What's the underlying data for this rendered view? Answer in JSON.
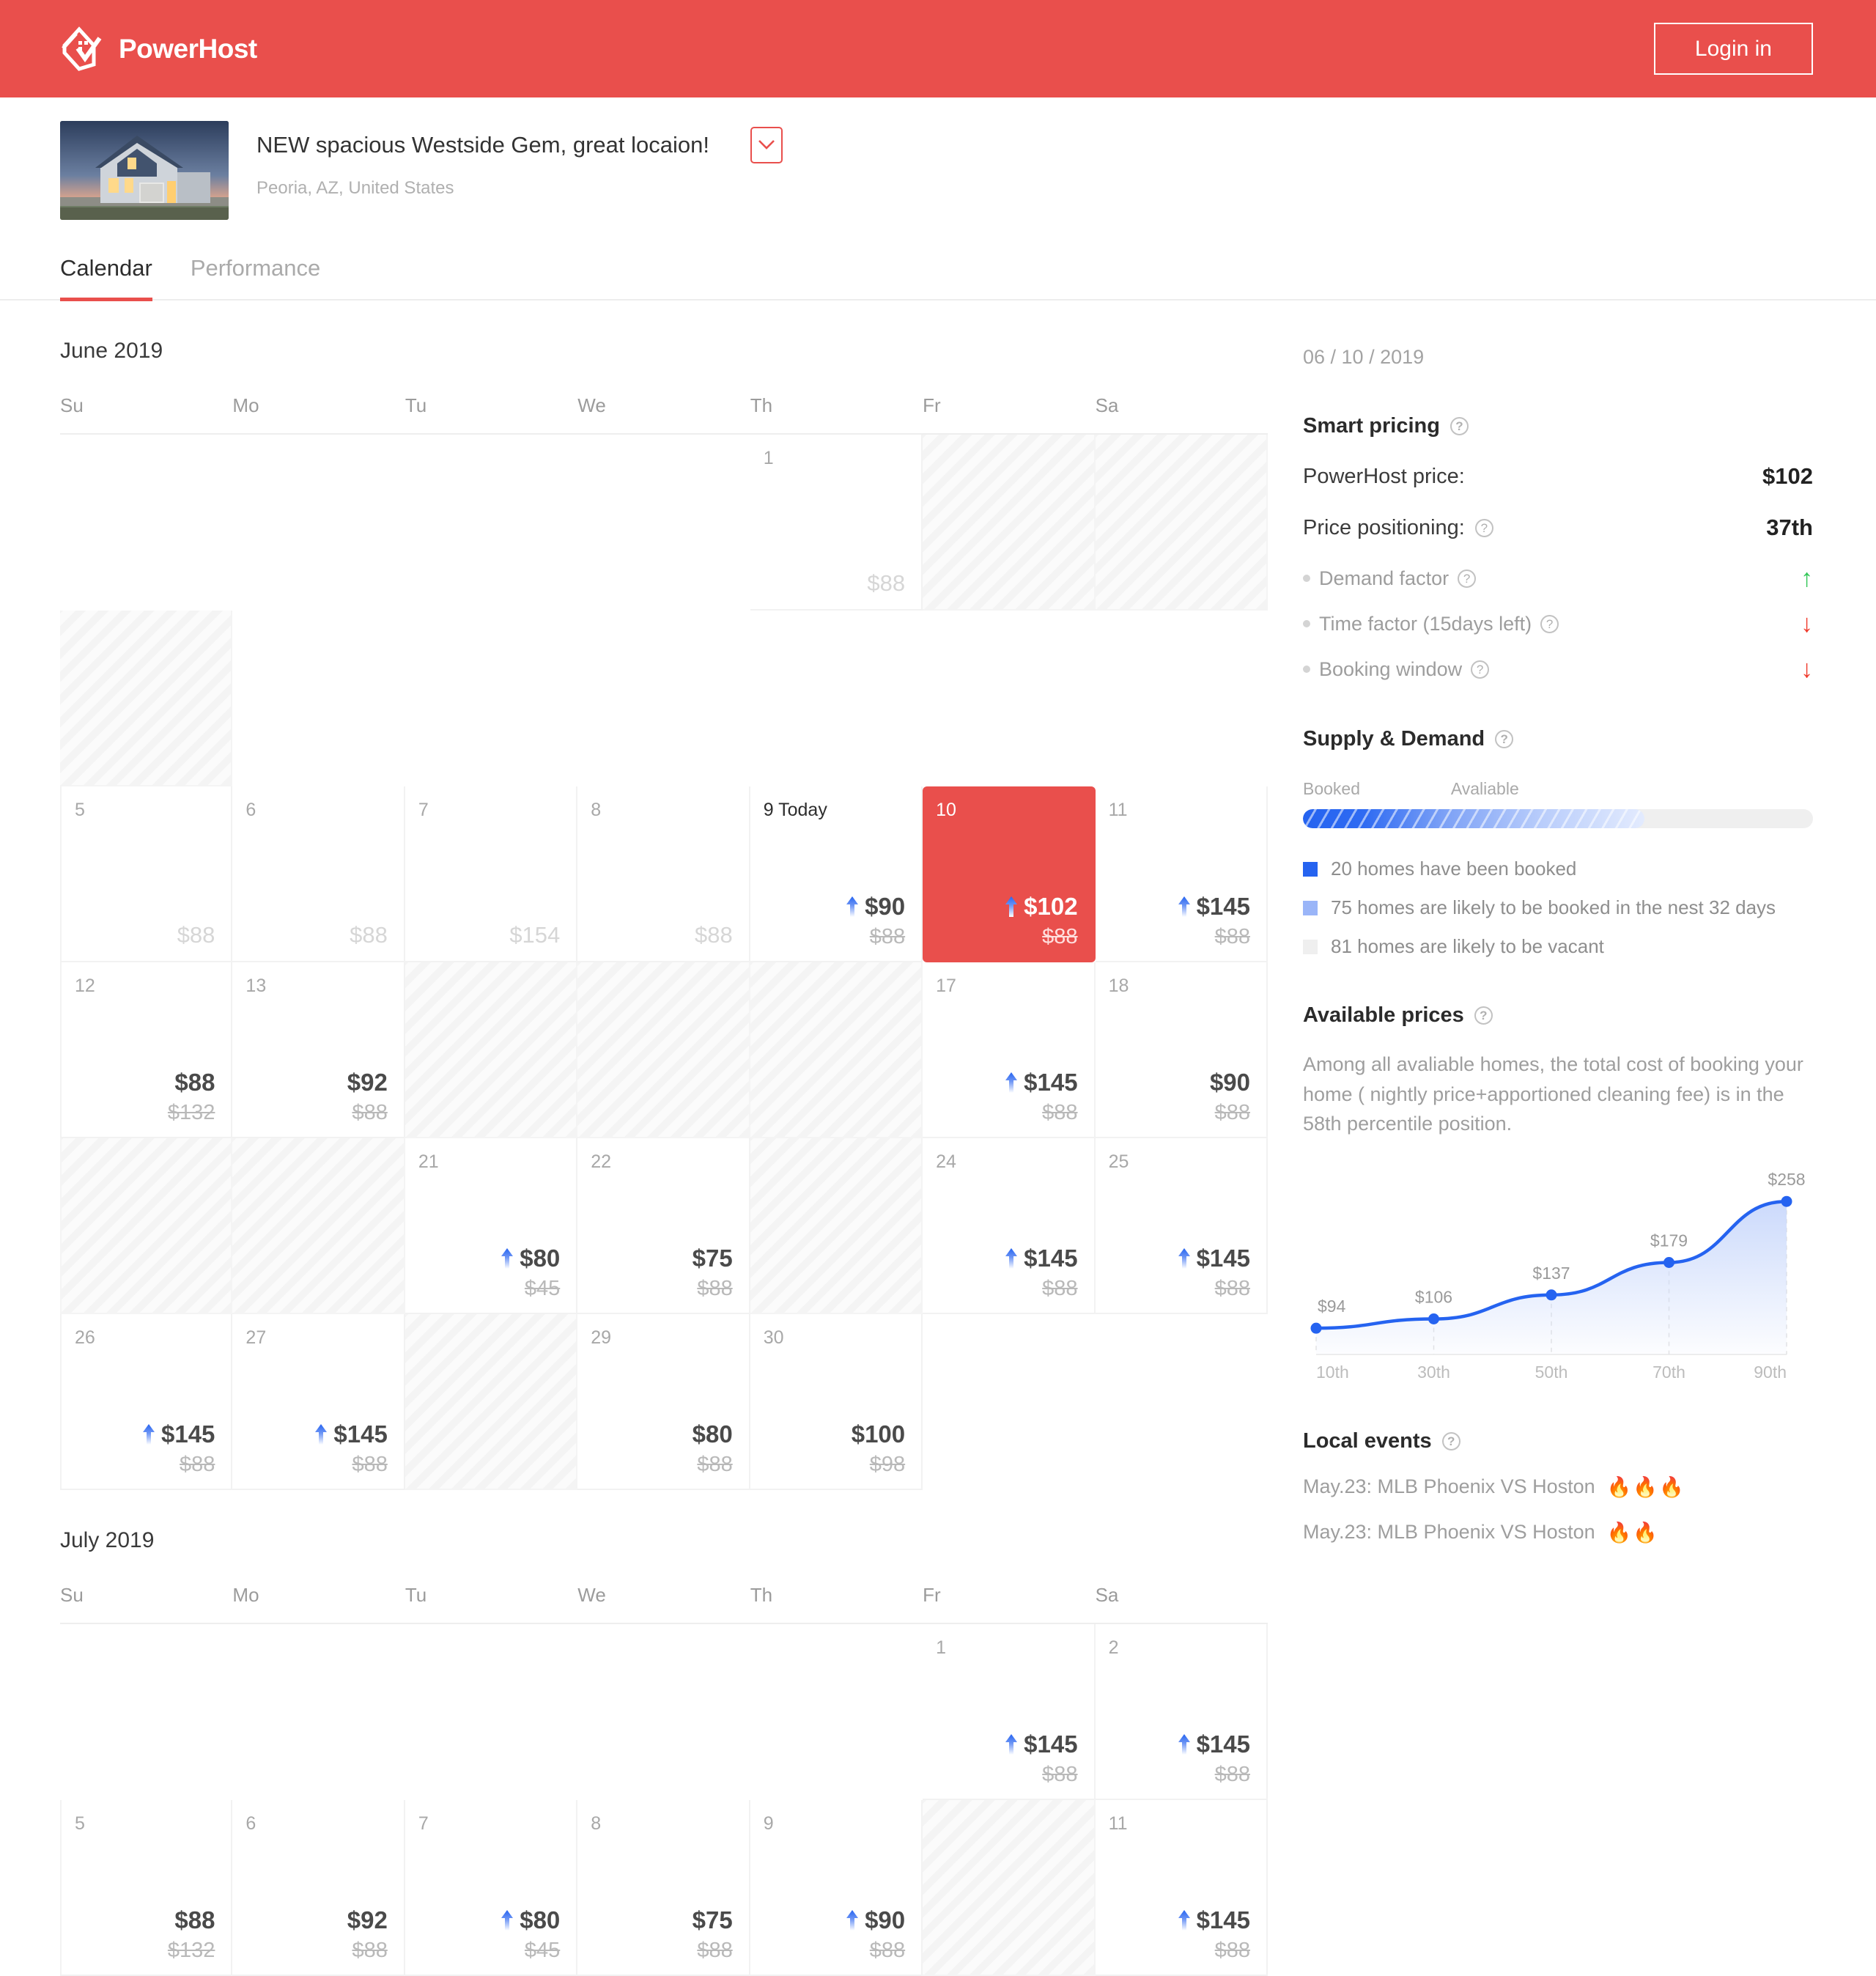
{
  "brand": {
    "name": "PowerHost",
    "logo_icon": "powerhost-logo-icon"
  },
  "header": {
    "login_label": "Login in"
  },
  "listing": {
    "title": "NEW spacious Westside Gem, great locaion!",
    "location": "Peoria, AZ, United States",
    "expand_icon": "chevron-down-icon",
    "thumbnail_alt": "house-photo"
  },
  "tabs": [
    {
      "label": "Calendar",
      "active": true
    },
    {
      "label": "Performance",
      "active": false
    }
  ],
  "calendar": {
    "dow": [
      "Su",
      "Mo",
      "Tu",
      "We",
      "Th",
      "Fr",
      "Sa"
    ],
    "months": [
      {
        "title": "June 2019",
        "weeks": [
          [
            {
              "type": "empty"
            },
            {
              "type": "empty"
            },
            {
              "type": "empty"
            },
            {
              "type": "empty"
            },
            {
              "type": "day",
              "day": "1",
              "faded": true,
              "price": "$88"
            },
            {
              "type": "blocked"
            },
            {
              "type": "blocked"
            },
            {
              "type": "blocked"
            }
          ],
          [
            {
              "type": "day",
              "day": "5",
              "faded": true,
              "price": "$88"
            },
            {
              "type": "day",
              "day": "6",
              "faded": true,
              "price": "$88"
            },
            {
              "type": "day",
              "day": "7",
              "faded": true,
              "price": "$154"
            },
            {
              "type": "day",
              "day": "8",
              "faded": true,
              "price": "$88"
            },
            {
              "type": "day",
              "day": "9",
              "today": true,
              "today_label": "Today",
              "price": "$90",
              "old": "$88",
              "arrow": true
            },
            {
              "type": "day",
              "day": "10",
              "selected": true,
              "price": "$102",
              "old": "$88",
              "arrow": true
            },
            {
              "type": "day",
              "day": "11",
              "price": "$145",
              "old": "$88",
              "arrow": true
            }
          ],
          [
            {
              "type": "day",
              "day": "12",
              "price": "$88",
              "old": "$132"
            },
            {
              "type": "day",
              "day": "13",
              "price": "$92",
              "old": "$88"
            },
            {
              "type": "blocked"
            },
            {
              "type": "blocked"
            },
            {
              "type": "blocked"
            },
            {
              "type": "day",
              "day": "17",
              "price": "$145",
              "old": "$88",
              "arrow": true
            },
            {
              "type": "day",
              "day": "18",
              "price": "$90",
              "old": "$88"
            }
          ],
          [
            {
              "type": "blocked"
            },
            {
              "type": "blocked"
            },
            {
              "type": "day",
              "day": "21",
              "price": "$80",
              "old": "$45",
              "arrow": true
            },
            {
              "type": "day",
              "day": "22",
              "price": "$75",
              "old": "$88"
            },
            {
              "type": "blocked"
            },
            {
              "type": "day",
              "day": "24",
              "price": "$145",
              "old": "$88",
              "arrow": true
            },
            {
              "type": "day",
              "day": "25",
              "price": "$145",
              "old": "$88",
              "arrow": true
            }
          ],
          [
            {
              "type": "day",
              "day": "26",
              "price": "$145",
              "old": "$88",
              "arrow": true
            },
            {
              "type": "day",
              "day": "27",
              "price": "$145",
              "old": "$88",
              "arrow": true
            },
            {
              "type": "blocked"
            },
            {
              "type": "day",
              "day": "29",
              "price": "$80",
              "old": "$88"
            },
            {
              "type": "day",
              "day": "30",
              "price": "$100",
              "old": "$98"
            },
            {
              "type": "empty"
            },
            {
              "type": "empty"
            }
          ]
        ]
      },
      {
        "title": "July 2019",
        "weeks": [
          [
            {
              "type": "empty"
            },
            {
              "type": "empty"
            },
            {
              "type": "empty"
            },
            {
              "type": "empty"
            },
            {
              "type": "empty"
            },
            {
              "type": "day",
              "day": "1",
              "price": "$145",
              "old": "$88",
              "arrow": true
            },
            {
              "type": "day",
              "day": "2",
              "price": "$145",
              "old": "$88",
              "arrow": true
            }
          ],
          [
            {
              "type": "day",
              "day": "5",
              "price": "$88",
              "old": "$132"
            },
            {
              "type": "day",
              "day": "6",
              "price": "$92",
              "old": "$88"
            },
            {
              "type": "day",
              "day": "7",
              "price": "$80",
              "old": "$45",
              "arrow": true
            },
            {
              "type": "day",
              "day": "8",
              "price": "$75",
              "old": "$88"
            },
            {
              "type": "day",
              "day": "9",
              "price": "$90",
              "old": "$88",
              "arrow": true
            },
            {
              "type": "blocked"
            },
            {
              "type": "day",
              "day": "11",
              "price": "$145",
              "old": "$88",
              "arrow": true
            }
          ]
        ]
      }
    ]
  },
  "panel": {
    "date": "06 / 10 / 2019",
    "smart_pricing": {
      "title": "Smart pricing",
      "rows": [
        {
          "label": "PowerHost price:",
          "value": "$102",
          "help": false
        },
        {
          "label": "Price positioning:",
          "value": "37th",
          "help": true
        }
      ],
      "factors": [
        {
          "label": "Demand factor",
          "trend": "up",
          "glyph": "↑"
        },
        {
          "label": "Time factor (15days left)",
          "trend": "down",
          "glyph": "↓"
        },
        {
          "label": "Booking window",
          "trend": "down",
          "glyph": "↓"
        }
      ]
    },
    "supply_demand": {
      "title": "Supply & Demand",
      "bar_left_label": "Booked",
      "bar_right_label": "Avaliable",
      "booked_percent": 67,
      "legend": [
        {
          "text": "20 homes have been booked",
          "color": "#2563f0"
        },
        {
          "text": "75 homes are likely to be booked in the nest 32 days",
          "color": "#9ab5f8"
        },
        {
          "text": "81 homes are likely to be vacant",
          "color": "#efefef"
        }
      ]
    },
    "available_prices": {
      "title": "Available  prices",
      "description": "Among all avaliable homes, the total cost of booking your home ( nightly price+apportioned cleaning fee) is in the 58th percentile position."
    },
    "local_events": {
      "title": "Local events",
      "items": [
        {
          "text": "May.23: MLB Phoenix VS Hoston",
          "flames": "🔥🔥🔥"
        },
        {
          "text": "May.23: MLB Phoenix VS Hoston",
          "flames": "🔥🔥"
        }
      ]
    }
  },
  "chart_data": {
    "type": "area",
    "title": "Available prices percentile curve",
    "x": [
      "10th",
      "30th",
      "50th",
      "70th",
      "90th"
    ],
    "values": [
      94,
      106,
      137,
      179,
      258
    ],
    "point_labels": [
      "$94",
      "$106",
      "$137",
      "$179",
      "$258"
    ],
    "xlabel": "",
    "ylabel": "",
    "ylim": [
      60,
      280
    ],
    "grid": true,
    "legend": "none",
    "line_color": "#2563f0",
    "fill_color": "#c9d8fb"
  },
  "colors": {
    "brand": "#e94f4c",
    "accent_blue": "#2563f0",
    "up": "#34c759",
    "down": "#ef3b2d",
    "flame": "#f5a623"
  }
}
